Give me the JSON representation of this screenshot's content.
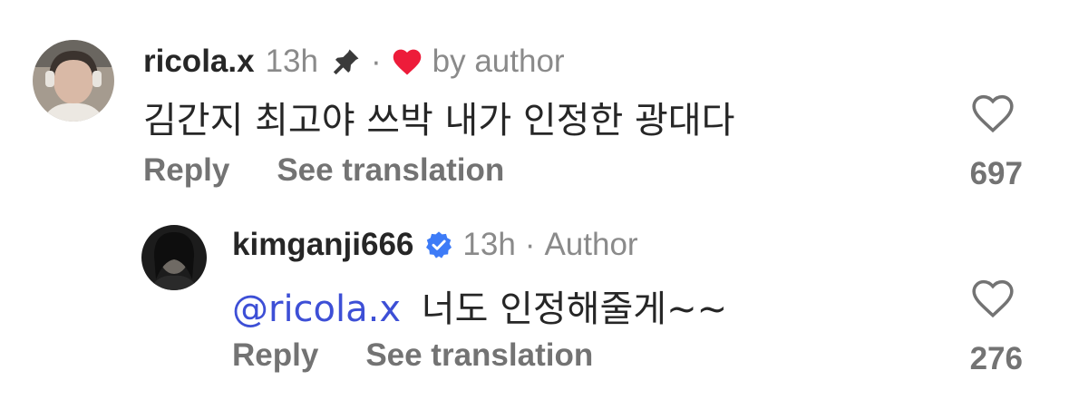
{
  "comments": [
    {
      "username": "ricola.x",
      "time": "13h",
      "pinned_icon": "pin-icon",
      "liked_by_author_icon": "heart-icon",
      "liked_by_author_text": "by author",
      "body": "김간지 최고야 쓰박 내가 인정한 광대다",
      "reply_label": "Reply",
      "translate_label": "See translation",
      "like_count": "697"
    },
    {
      "username": "kimganji666",
      "verified_icon": "verified-badge-icon",
      "time": "13h",
      "role": "Author",
      "mention": "@ricola.x",
      "body": "너도 인정해줄게~~",
      "reply_label": "Reply",
      "translate_label": "See translation",
      "like_count": "276"
    }
  ],
  "colors": {
    "username": "#262626",
    "meta": "#8a8a8a",
    "mention": "#3d4fd6",
    "heart": "#ed1c3a",
    "verified": "#3d7bf7"
  }
}
